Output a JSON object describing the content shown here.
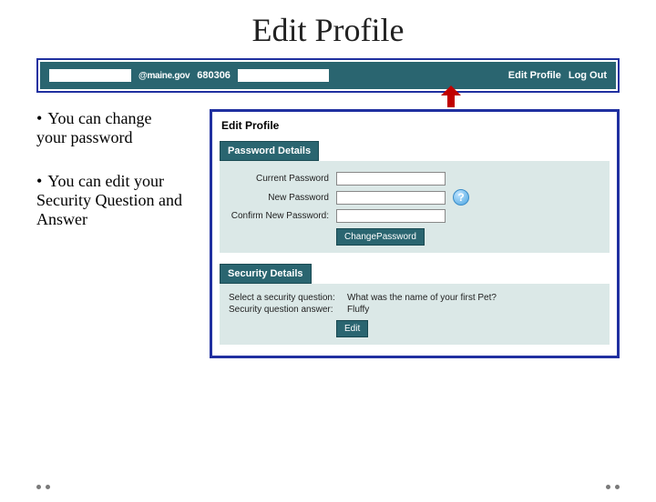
{
  "title": "Edit Profile",
  "topbar": {
    "email_domain": "@maine.gov",
    "account_number": "680306",
    "edit_profile_link": "Edit Profile",
    "logout_link": "Log Out"
  },
  "bullets": {
    "item1": "You can change your password",
    "item2": "You can edit your Security Question and Answer"
  },
  "app": {
    "heading": "Edit Profile",
    "password_section": {
      "title": "Password Details",
      "current_label": "Current Password",
      "new_label": "New Password",
      "confirm_label": "Confirm New Password:",
      "button": "ChangePassword"
    },
    "security_section": {
      "title": "Security Details",
      "question_label": "Select a security question:",
      "question_value": "What was the name of your first Pet?",
      "answer_label": "Security question answer:",
      "answer_value": "Fluffy",
      "button": "Edit"
    }
  }
}
